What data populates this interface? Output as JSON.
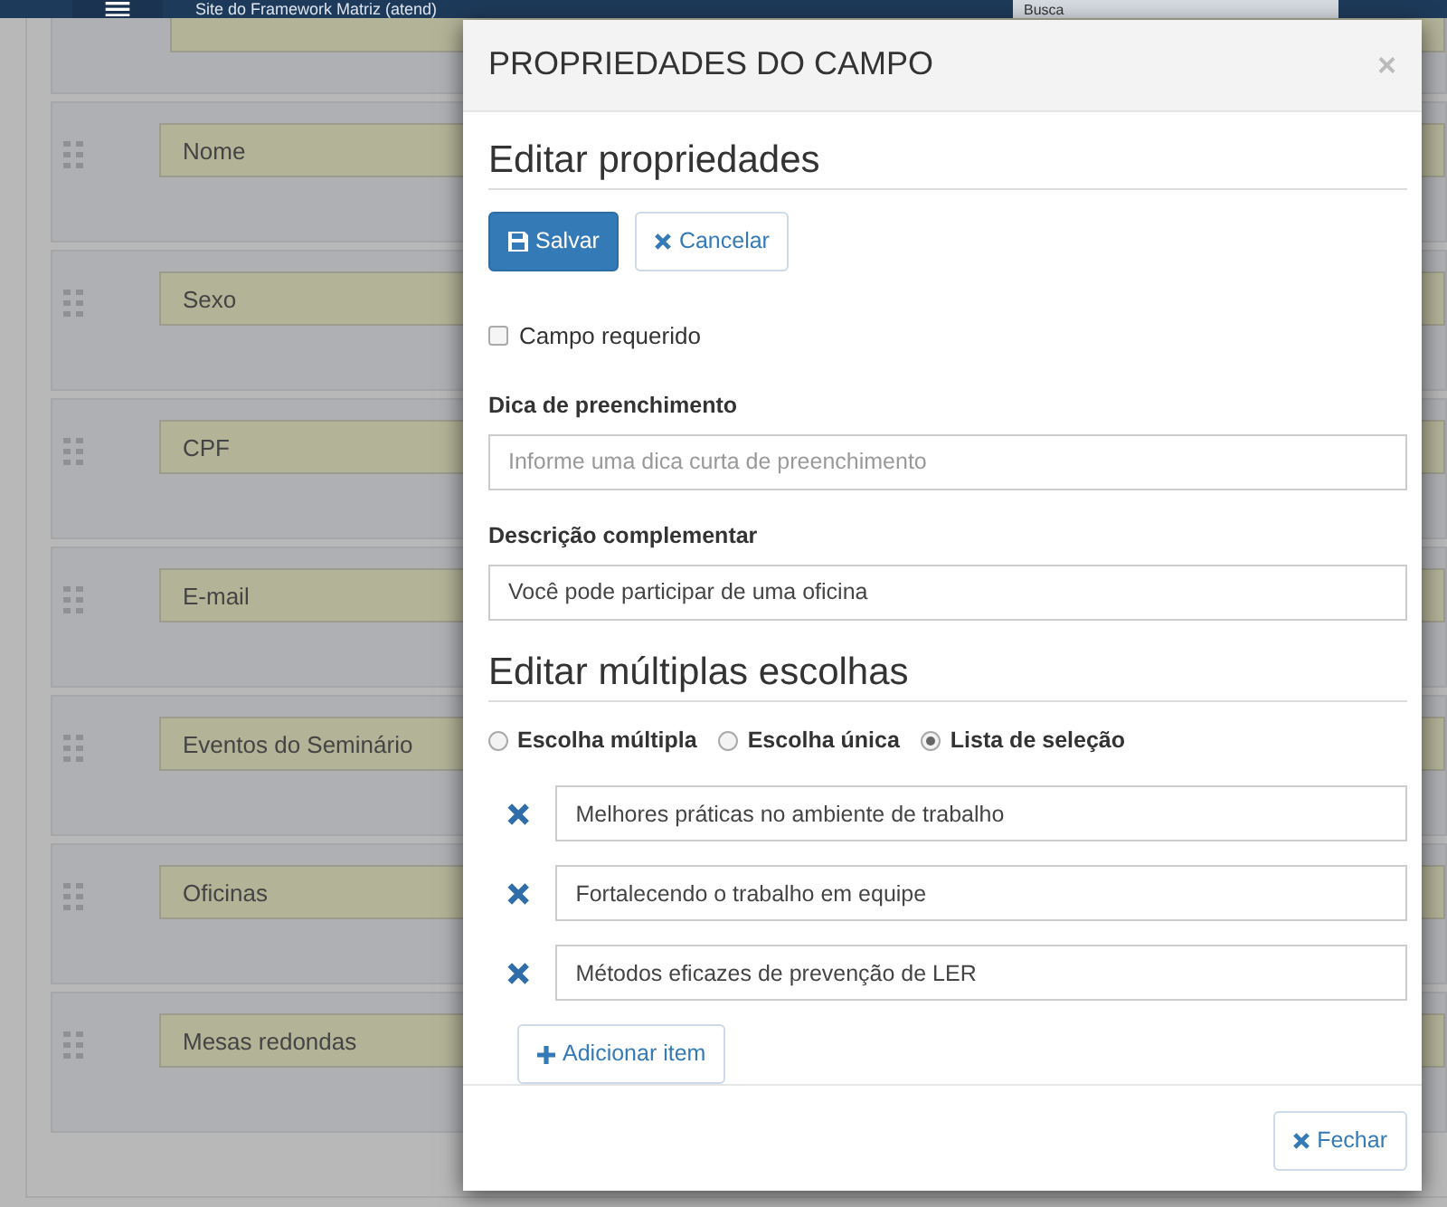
{
  "navbar": {
    "title": "Site do Framework Matriz (atend)",
    "search_placeholder": "Busca"
  },
  "form_rows": [
    "Nome",
    "Sexo",
    "CPF",
    "E-mail",
    "Eventos do Seminário",
    "Oficinas",
    "Mesas redondas"
  ],
  "modal": {
    "title": "PROPRIEDADES DO CAMPO",
    "close": "×",
    "properties_heading": "Editar propriedades",
    "save_button": "Salvar",
    "cancel_button": "Cancelar",
    "required": {
      "label": "Campo requerido",
      "checked": false
    },
    "hint": {
      "label": "Dica de preenchimento",
      "placeholder": "Informe uma dica curta de preenchimento"
    },
    "description": {
      "label": "Descrição complementar",
      "value": "Você pode participar de uma oficina"
    },
    "choices_heading": "Editar múltiplas escolhas",
    "choice_types": [
      {
        "label": "Escolha múltipla",
        "selected": false
      },
      {
        "label": "Escolha única",
        "selected": false
      },
      {
        "label": "Lista de seleção",
        "selected": true
      }
    ],
    "items": [
      "Melhores práticas no ambiente de trabalho",
      "Fortalecendo o trabalho em equipe",
      "Métodos eficazes de prevenção de LER"
    ],
    "add_button": "Adicionar item",
    "close_button": "Fechar"
  }
}
